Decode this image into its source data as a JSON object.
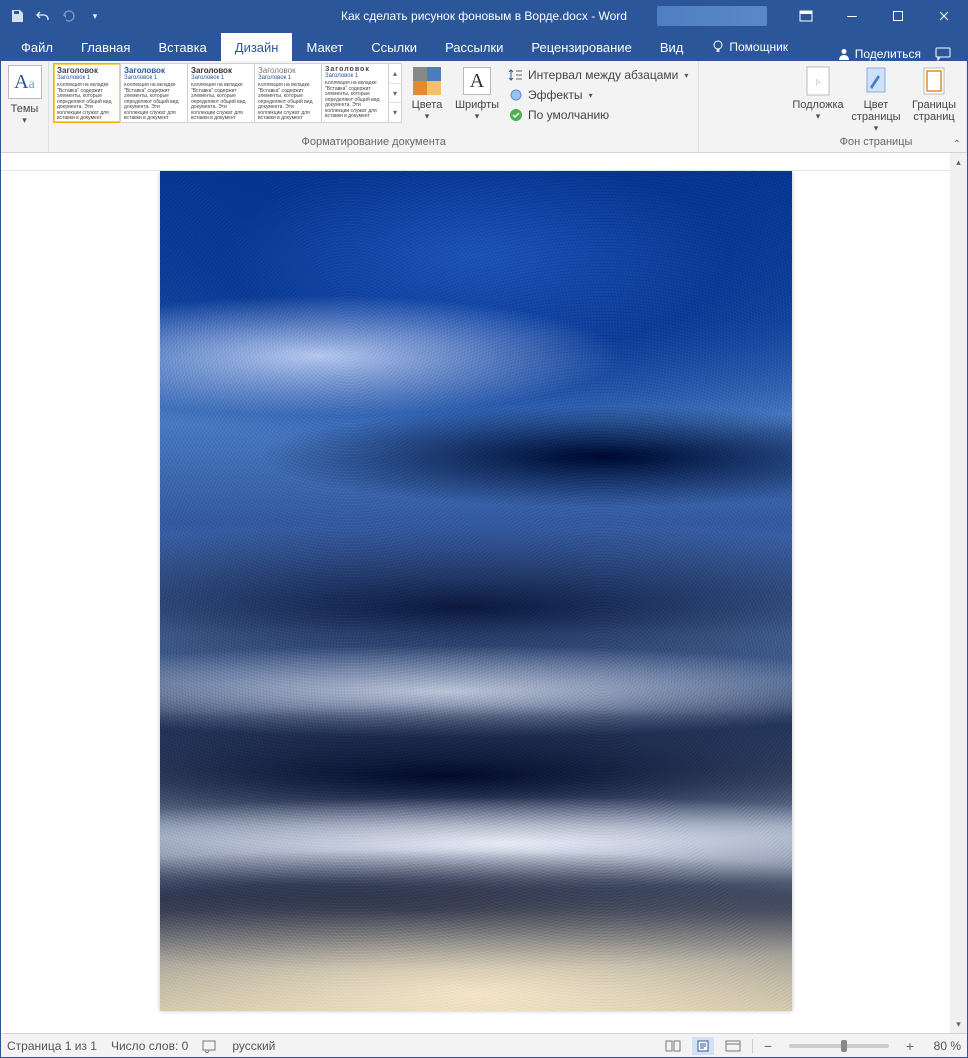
{
  "titlebar": {
    "doc_title": "Как сделать рисунок фоновым в Ворде.docx  -  Word"
  },
  "tabs": {
    "file": "Файл",
    "home": "Главная",
    "insert": "Вставка",
    "design": "Дизайн",
    "layout": "Макет",
    "references": "Ссылки",
    "mailings": "Рассылки",
    "review": "Рецензирование",
    "view": "Вид",
    "tell_me": "Помощник",
    "share": "Поделиться"
  },
  "ribbon": {
    "themes_label": "Темы",
    "formatting_group": "Форматирование документа",
    "gallery": {
      "hd": "Заголовок",
      "sub": "Заголовок 1",
      "body": "Коллекция на вкладке \"Вставка\" содержит элементы, которые определяют общий вид документа. Эти коллекции служат для вставки в документ"
    },
    "colors": "Цвета",
    "fonts": "Шрифты",
    "spacing": "Интервал между абзацами",
    "effects": "Эффекты",
    "default": "По умолчанию",
    "page_bg_group": "Фон страницы",
    "watermark": "Подложка",
    "page_color": "Цвет страницы",
    "page_borders": "Границы страниц"
  },
  "status": {
    "page": "Страница 1 из 1",
    "words": "Число слов: 0",
    "lang": "русский",
    "zoom": "80 %"
  }
}
